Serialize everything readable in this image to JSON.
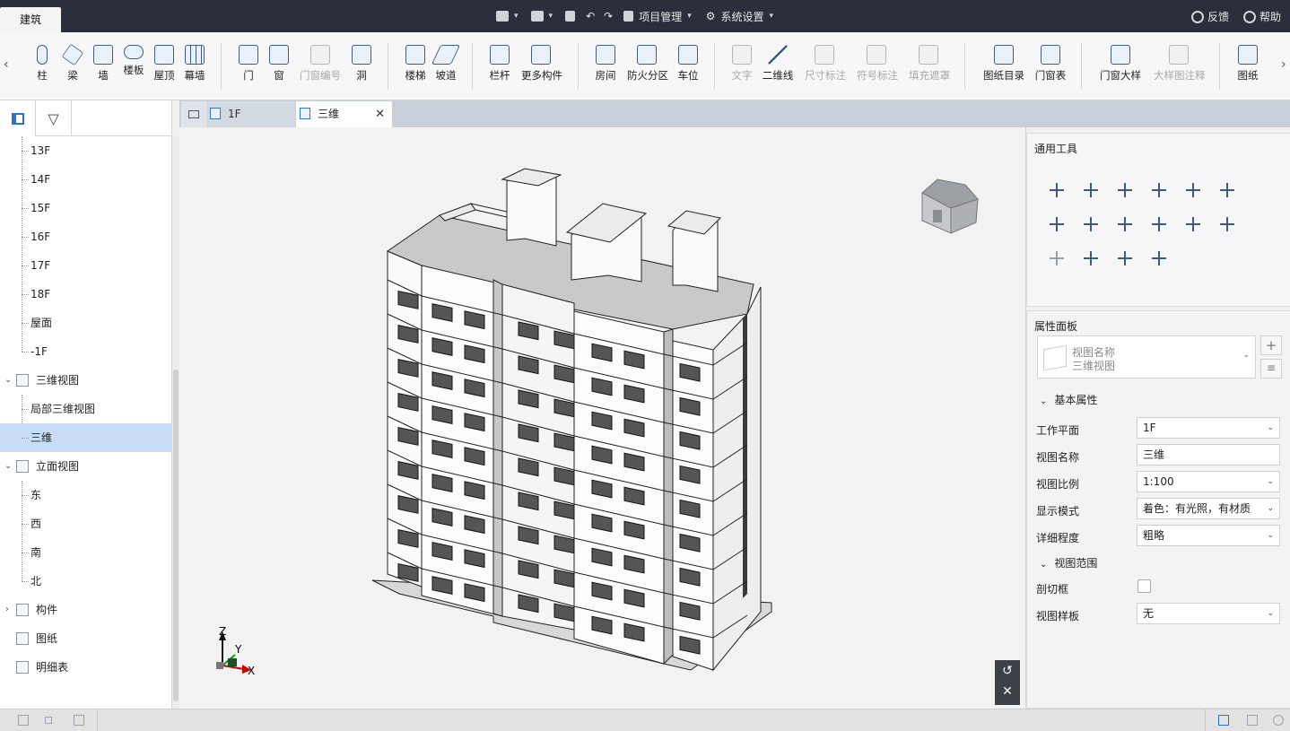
{
  "titlebar": {
    "app_tab": "建筑",
    "project_menu": "项目管理",
    "settings_menu": "系统设置",
    "feedback": "反馈",
    "help": "帮助"
  },
  "ribbon": {
    "groups": [
      [
        "柱",
        "梁",
        "墙",
        "楼板",
        "屋顶",
        "幕墙"
      ],
      [
        "门",
        "窗",
        "门窗编号",
        "洞"
      ],
      [
        "楼梯",
        "坡道"
      ],
      [
        "栏杆",
        "更多构件"
      ],
      [
        "房间",
        "防火分区",
        "车位"
      ],
      [
        "文字",
        "二维线",
        "尺寸标注",
        "符号标注",
        "填充遮罩"
      ],
      [
        "图纸目录",
        "门窗表"
      ],
      [
        "门窗大样",
        "大样图注释"
      ],
      [
        "图纸"
      ]
    ],
    "buttons": {
      "column": "柱",
      "beam": "梁",
      "wall": "墙",
      "slab": "楼板",
      "roof": "屋顶",
      "curtain_wall": "幕墙",
      "door": "门",
      "window": "窗",
      "door_window_no": "门窗编号",
      "opening": "洞",
      "stair": "楼梯",
      "ramp": "坡道",
      "railing": "栏杆",
      "more": "更多构件",
      "room": "房间",
      "fire_zone": "防火分区",
      "parking": "车位",
      "text": "文字",
      "line2d": "二维线",
      "dimension": "尺寸标注",
      "symbol": "符号标注",
      "fill_mask": "填充遮罩",
      "drawing_list": "图纸目录",
      "door_window_table": "门窗表",
      "door_window_detail": "门窗大样",
      "detail_note": "大样图注释",
      "drawings": "图纸"
    }
  },
  "tree": {
    "floors": [
      "13F",
      "14F",
      "15F",
      "16F",
      "17F",
      "18F",
      "屋面",
      "-1F"
    ],
    "view3d": "三维视图",
    "view3d_items": [
      "局部三维视图",
      "三维"
    ],
    "elevation": "立面视图",
    "elevation_items": [
      "东",
      "西",
      "南",
      "北"
    ],
    "components": "构件",
    "sheets": "图纸",
    "schedules": "明细表"
  },
  "doc_tabs": [
    "1F",
    "三维"
  ],
  "tools_panel": {
    "title": "通用工具"
  },
  "props": {
    "title": "属性面板",
    "view_name_label": "视图名称",
    "view_name_value": "三维视图",
    "basic": "基本属性",
    "rows": [
      {
        "label": "工作平面",
        "value": "1F",
        "dropdown": true
      },
      {
        "label": "视图名称",
        "value": "三维",
        "dropdown": false
      },
      {
        "label": "视图比例",
        "value": "1:100",
        "dropdown": true
      },
      {
        "label": "显示模式",
        "value": "着色：有光照，有材质",
        "dropdown": true
      },
      {
        "label": "详细程度",
        "value": "粗略",
        "dropdown": true
      }
    ],
    "range": "视图范围",
    "section_box": "剖切框",
    "view_template": "视图样板",
    "view_template_value": "无"
  },
  "axis": {
    "x": "X",
    "y": "Y",
    "z": "Z"
  }
}
